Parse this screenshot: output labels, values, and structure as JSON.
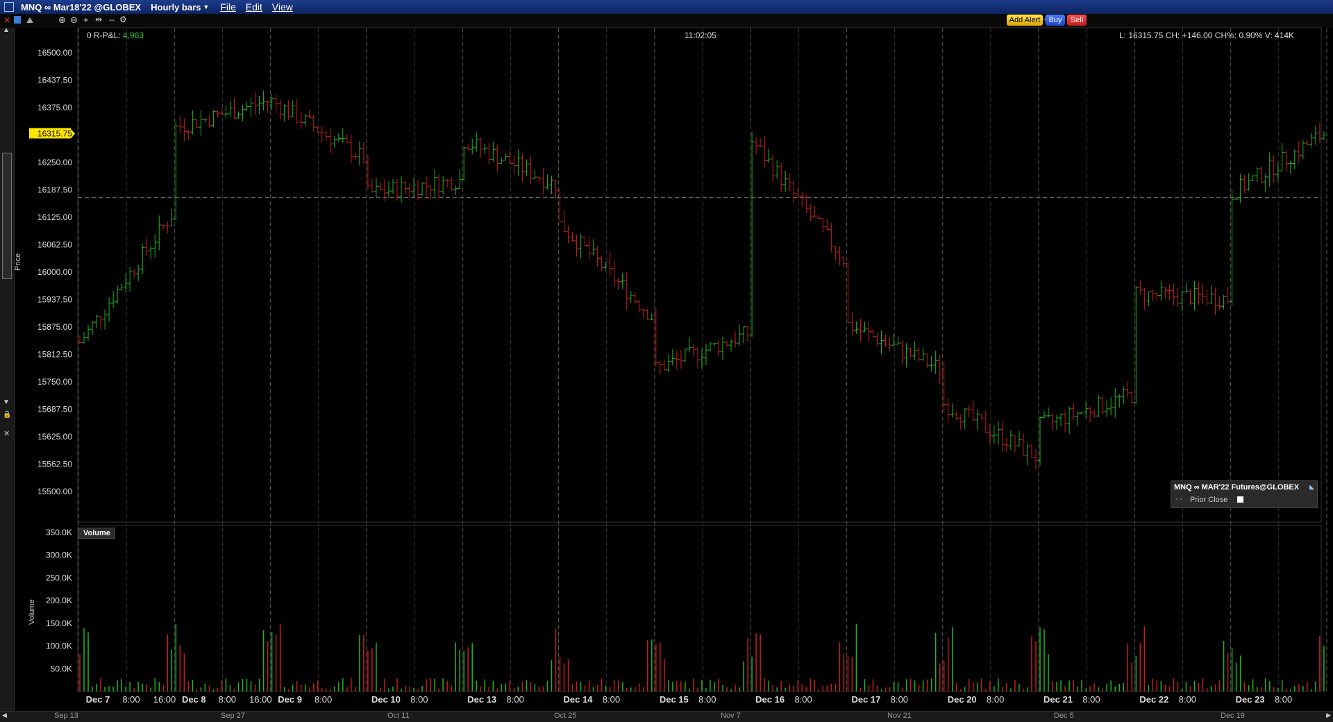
{
  "window": {
    "title": "MNQ ∞ Mar18'22 @GLOBEX",
    "bar_size": "Hourly bars",
    "menu": [
      "File",
      "Edit",
      "View"
    ]
  },
  "toolbar": {
    "add_alert": "Add Alert",
    "buy": "Buy",
    "sell": "Sell"
  },
  "header": {
    "rpl_prefix": "0 R-P&L:",
    "rpl_value": "4,963",
    "time": "11:02:05",
    "quote": "L: 16315.75 CH: +146.00 CH%: 0.90% V: 414K"
  },
  "price_panel": {
    "ylabel": "Price",
    "last_price_tag": "16315.75",
    "ticks": [
      "16500.00",
      "16437.50",
      "16375.00",
      "16315.75",
      "16250.00",
      "16187.50",
      "16125.00",
      "16062.50",
      "16000.00",
      "15937.50",
      "15875.00",
      "15812.50",
      "15750.00",
      "15687.50",
      "15625.00",
      "15562.50",
      "15500.00"
    ],
    "legend": {
      "title": "MNQ ∞ MAR'22 Futures@GLOBEX",
      "item": "Prior Close"
    }
  },
  "volume_panel": {
    "title": "Volume",
    "ylabel": "Volume",
    "ticks": [
      "350.0K",
      "300.0K",
      "250.0K",
      "200.0K",
      "150.0K",
      "100.0K",
      "50.0K"
    ]
  },
  "x_axis": {
    "labels": [
      {
        "text": "Dec 7",
        "bold": true
      },
      {
        "text": "8:00",
        "bold": false
      },
      {
        "text": "16:00",
        "bold": false
      },
      {
        "text": "Dec 8",
        "bold": true
      },
      {
        "text": "8:00",
        "bold": false
      },
      {
        "text": "16:00",
        "bold": false
      },
      {
        "text": "Dec 9",
        "bold": true
      },
      {
        "text": "8:00",
        "bold": false
      },
      {
        "text": "Dec 10",
        "bold": true
      },
      {
        "text": "8:00",
        "bold": false
      },
      {
        "text": "Dec 13",
        "bold": true
      },
      {
        "text": "8:00",
        "bold": false
      },
      {
        "text": "Dec 14",
        "bold": true
      },
      {
        "text": "8:00",
        "bold": false
      },
      {
        "text": "Dec 15",
        "bold": true
      },
      {
        "text": "8:00",
        "bold": false
      },
      {
        "text": "Dec 16",
        "bold": true
      },
      {
        "text": "8:00",
        "bold": false
      },
      {
        "text": "Dec 17",
        "bold": true
      },
      {
        "text": "8:00",
        "bold": false
      },
      {
        "text": "Dec 20",
        "bold": true
      },
      {
        "text": "8:00",
        "bold": false
      },
      {
        "text": "Dec 21",
        "bold": true
      },
      {
        "text": "8:00",
        "bold": false
      },
      {
        "text": "Dec 22",
        "bold": true
      },
      {
        "text": "8:00",
        "bold": false
      },
      {
        "text": "Dec 23",
        "bold": true
      },
      {
        "text": "8:00",
        "bold": false
      }
    ],
    "overview_labels": [
      "Sep 13",
      "Sep 27",
      "Oct 11",
      "Oct 25",
      "Nov 7",
      "Nov 21",
      "Dec 5",
      "Dec 19"
    ]
  },
  "colors": {
    "up": "#1fb81f",
    "down": "#c81e1e",
    "price_tag": "#ffe600",
    "background": "#000000"
  },
  "chart_data": {
    "type": "bar",
    "subtype": "ohlc",
    "ylim": [
      15475,
      16525
    ],
    "volume_ylim": [
      0,
      360000
    ],
    "grid": true,
    "legend_position": "bottom-right",
    "day_anchors": [
      {
        "label": "Dec 7",
        "close_start": 15840,
        "close_end": 16130
      },
      {
        "label": "Dec 8",
        "close_start": 16330,
        "close_end": 16390
      },
      {
        "label": "Dec 9",
        "close_start": 16390,
        "close_end": 16260
      },
      {
        "label": "Dec 10",
        "close_start": 16180,
        "close_end": 16210
      },
      {
        "label": "Dec 13",
        "close_start": 16300,
        "close_end": 16200
      },
      {
        "label": "Dec 14",
        "close_start": 16110,
        "close_end": 15900
      },
      {
        "label": "Dec 15",
        "close_start": 15780,
        "close_end": 15860
      },
      {
        "label": "Dec 16",
        "close_start": 16300,
        "close_end": 16030
      },
      {
        "label": "Dec 17",
        "close_start": 15880,
        "close_end": 15780
      },
      {
        "label": "Dec 20",
        "close_start": 15700,
        "close_end": 15580
      },
      {
        "label": "Dec 21",
        "close_start": 15650,
        "close_end": 15720
      },
      {
        "label": "Dec 22",
        "close_start": 15950,
        "close_end": 15940
      },
      {
        "label": "Dec 23",
        "close_start": 16180,
        "close_end": 16315.75
      }
    ]
  }
}
